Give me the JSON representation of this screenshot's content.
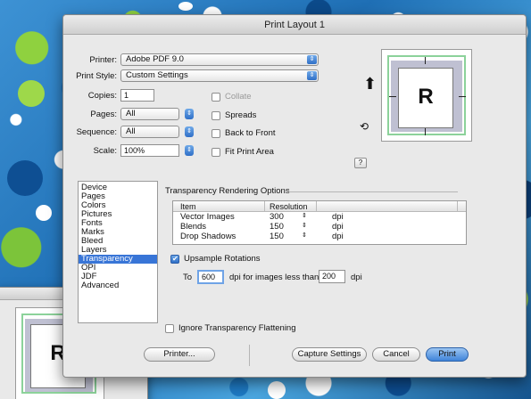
{
  "window": {
    "title": "Print Layout 1"
  },
  "printer": {
    "label": "Printer:",
    "value": "Adobe PDF 9.0"
  },
  "print_style": {
    "label": "Print Style:",
    "value": "Custom Settings"
  },
  "copies": {
    "label": "Copies:",
    "value": "1"
  },
  "pages": {
    "label": "Pages:",
    "value": "All"
  },
  "sequence": {
    "label": "Sequence:",
    "value": "All"
  },
  "scale": {
    "label": "Scale:",
    "value": "100%"
  },
  "checks": {
    "collate": {
      "label": "Collate",
      "checked": false,
      "enabled": false
    },
    "spreads": {
      "label": "Spreads",
      "checked": false
    },
    "back_to_front": {
      "label": "Back to Front",
      "checked": false
    },
    "fit_print_area": {
      "label": "Fit Print Area",
      "checked": false
    }
  },
  "preview": {
    "letter": "R",
    "help": "?"
  },
  "categories": [
    "Device",
    "Pages",
    "Colors",
    "Pictures",
    "Fonts",
    "Marks",
    "Bleed",
    "Layers",
    "Transparency",
    "OPI",
    "JDF",
    "Advanced"
  ],
  "selected_category": "Transparency",
  "transparency": {
    "group_title": "Transparency Rendering Options",
    "columns": [
      "Item",
      "Resolution"
    ],
    "rows": [
      {
        "item": "Vector Images",
        "resolution": "300",
        "unit": "dpi"
      },
      {
        "item": "Blends",
        "resolution": "150",
        "unit": "dpi"
      },
      {
        "item": "Drop Shadows",
        "resolution": "150",
        "unit": "dpi"
      }
    ],
    "upsample": {
      "label": "Upsample Rotations",
      "checked": true
    },
    "to_label": "To",
    "to_value": "600",
    "dpi_for_label": "dpi for images less than",
    "less_than_value": "200",
    "dpi_label": "dpi",
    "ignore": {
      "label": "Ignore Transparency Flattening",
      "checked": false
    }
  },
  "buttons": {
    "printer": "Printer...",
    "capture": "Capture Settings",
    "cancel": "Cancel",
    "print": "Print"
  },
  "colors": {
    "accent": "#3875d7",
    "background": "#2d7fc4"
  }
}
